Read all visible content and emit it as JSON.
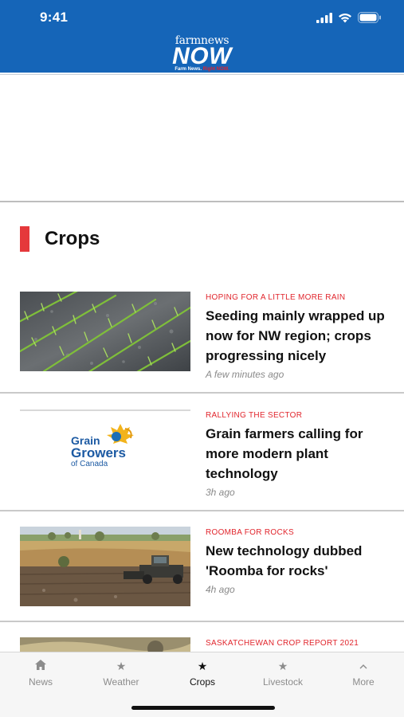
{
  "status_bar": {
    "time": "9:41"
  },
  "header": {
    "logo_top": "farmnews",
    "logo_main": "NOW",
    "logo_tag_white": "Farm News.",
    "logo_tag_red": "Right NOW."
  },
  "section": {
    "title": "Crops",
    "accent_color": "#e5383b"
  },
  "articles": [
    {
      "kicker": "HOPING FOR A LITTLE MORE RAIN",
      "headline": "Seeding mainly wrapped up now for NW region; crops progressing nicely",
      "time": "A few minutes ago",
      "image": "seedlings-photo"
    },
    {
      "kicker": "RALLYING THE SECTOR",
      "headline": "Grain farmers calling for more modern plant technology",
      "time": "3h ago",
      "image": "grain-growers-logo",
      "logo_text": {
        "line1": "Grain",
        "line2": "Growers",
        "line3": "of Canada"
      }
    },
    {
      "kicker": "ROOMBA FOR ROCKS",
      "headline": "New technology dubbed 'Roomba for rocks'",
      "time": "4h ago",
      "image": "field-machine-photo"
    },
    {
      "kicker": "SASKATCHEWAN CROP REPORT 2021",
      "headline": "",
      "time": "",
      "image": "crop-photo"
    }
  ],
  "tabbar": {
    "tabs": [
      {
        "label": "News",
        "icon": "home-icon"
      },
      {
        "label": "Weather",
        "icon": "star-icon"
      },
      {
        "label": "Crops",
        "icon": "star-icon",
        "active": true
      },
      {
        "label": "Livestock",
        "icon": "star-icon"
      },
      {
        "label": "More",
        "icon": "chevron-up-icon"
      }
    ]
  },
  "colors": {
    "header_blue": "#1565b8",
    "kicker_red": "#e1262d"
  }
}
